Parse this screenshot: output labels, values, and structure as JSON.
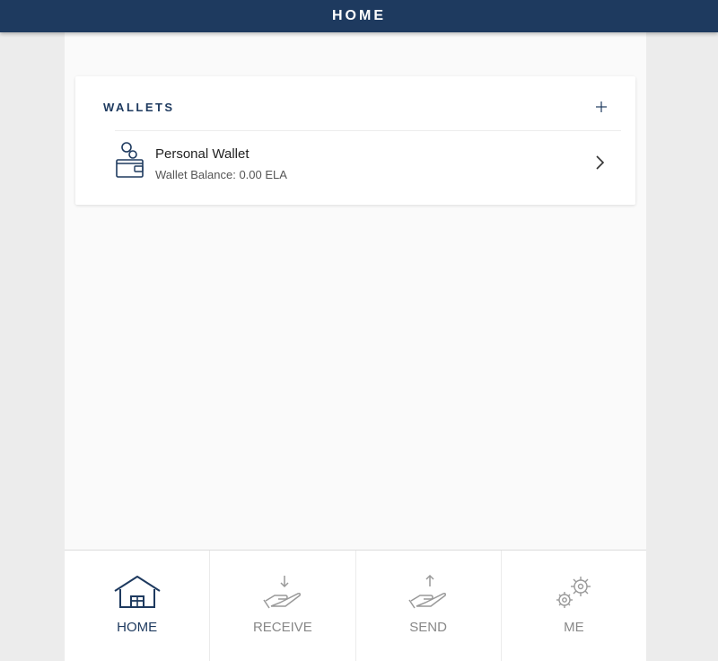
{
  "header": {
    "title": "HOME"
  },
  "wallets": {
    "section_title": "WALLETS",
    "items": [
      {
        "name": "Personal Wallet",
        "balance": "Wallet Balance: 0.00 ELA"
      }
    ]
  },
  "tabs": [
    {
      "label": "HOME",
      "icon": "home-icon",
      "active": true
    },
    {
      "label": "RECEIVE",
      "icon": "receive-icon",
      "active": false
    },
    {
      "label": "SEND",
      "icon": "send-icon",
      "active": false
    },
    {
      "label": "ME",
      "icon": "gears-icon",
      "active": false
    }
  ],
  "colors": {
    "primary": "#1e3a5f",
    "inactive": "#888888",
    "background": "#ececec"
  }
}
